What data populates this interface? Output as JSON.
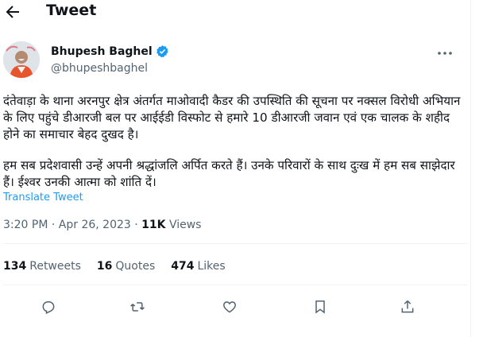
{
  "header": {
    "title": "Tweet",
    "back_icon": "arrow-left-icon"
  },
  "author": {
    "name": "Bhupesh Baghel",
    "handle": "@bhupeshbaghel",
    "verified_icon": "verified-badge-icon",
    "verified_color": "#1d9bf0"
  },
  "tweet": {
    "paragraphs": [
      "दंतेवाड़ा के थाना अरनपुर क्षेत्र अंतर्गत माओवादी कैडर की उपस्थिति की सूचना पर नक्सल विरोधी अभियान के लिए पहुंचे डीआरजी बल पर आईईडी विस्फोट से हमारे 10 डीआरजी जवान एवं एक चालक के शहीद होने का समाचार बेहद दुखद है।",
      "हम सब प्रदेशवासी उन्हें अपनी श्रद्धांजलि अर्पित करते हैं। उनके परिवारों के साथ दुःख में हम सब साझेदार हैं। ईश्वर उनकी आत्मा को शांति दें।"
    ],
    "translate_label": "Translate Tweet",
    "time": "3:20 PM",
    "date": "Apr 26, 2023",
    "views_count": "11K",
    "views_label": "Views"
  },
  "stats": {
    "retweets_count": "134",
    "retweets_label": "Retweets",
    "quotes_count": "16",
    "quotes_label": "Quotes",
    "likes_count": "474",
    "likes_label": "Likes"
  },
  "actions": [
    "reply-icon",
    "retweet-icon",
    "like-icon",
    "bookmark-icon",
    "share-icon"
  ],
  "colors": {
    "link": "#1d9bf0",
    "muted": "#536471",
    "text": "#0f1419"
  }
}
